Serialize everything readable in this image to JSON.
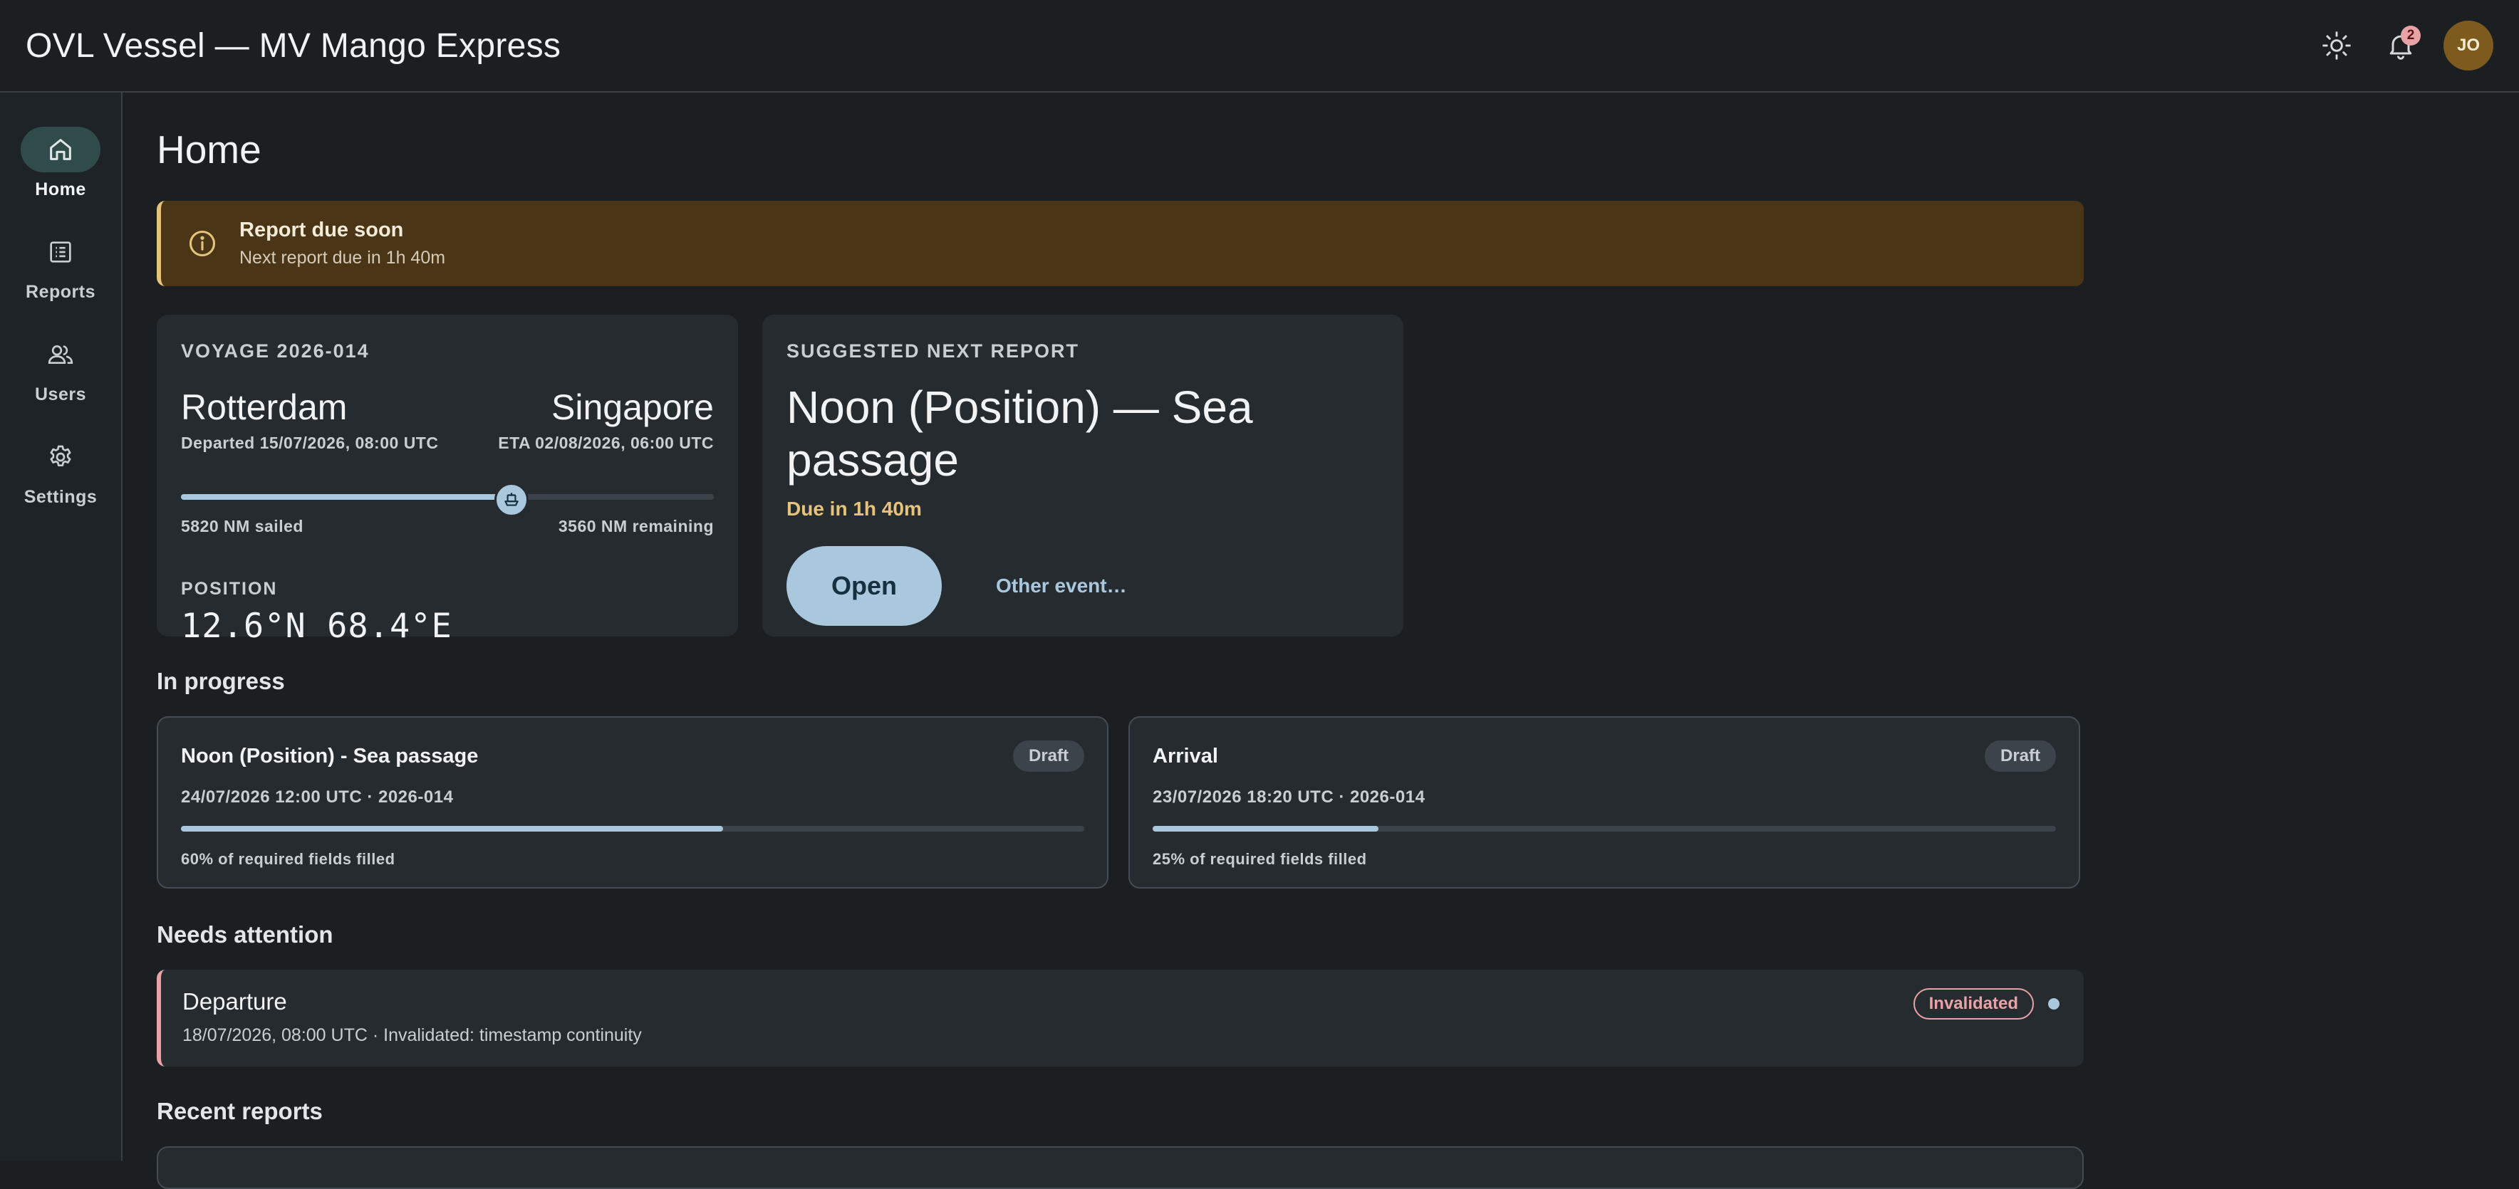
{
  "app": {
    "title": "OVL Vessel — MV Mango Express"
  },
  "header": {
    "notification_count": "2",
    "avatar_initials": "JO"
  },
  "sidebar": {
    "items": [
      {
        "label": "Home",
        "icon": "home-icon",
        "active": true
      },
      {
        "label": "Reports",
        "icon": "reports-icon",
        "active": false
      },
      {
        "label": "Users",
        "icon": "users-icon",
        "active": false
      },
      {
        "label": "Settings",
        "icon": "gear-icon",
        "active": false
      }
    ]
  },
  "page": {
    "title": "Home"
  },
  "banner": {
    "title": "Report due soon",
    "subtitle": "Next report due in 1h 40m"
  },
  "voyage": {
    "label": "VOYAGE 2026-014",
    "origin": "Rotterdam",
    "destination": "Singapore",
    "departed": "Departed 15/07/2026, 08:00 UTC",
    "eta": "ETA 02/08/2026, 06:00 UTC",
    "sailed": "5820 NM sailed",
    "remaining": "3560 NM remaining",
    "progress_fraction": 0.62,
    "position_label": "POSITION",
    "position_value": "12.6°N 68.4°E"
  },
  "next_report": {
    "label": "SUGGESTED NEXT REPORT",
    "title": "Noon (Position) — Sea passage",
    "due": "Due in 1h 40m",
    "open_label": "Open",
    "other_label": "Other event…"
  },
  "sections": {
    "in_progress": "In progress",
    "needs_attention": "Needs attention",
    "recent_reports": "Recent reports"
  },
  "in_progress": [
    {
      "title": "Noon (Position) - Sea passage",
      "status": "Draft",
      "meta": "24/07/2026 12:00 UTC · 2026-014",
      "progress": 0.6,
      "footer": "60% of required fields filled"
    },
    {
      "title": "Arrival",
      "status": "Draft",
      "meta": "23/07/2026 18:20 UTC · 2026-014",
      "progress": 0.25,
      "footer": "25% of required fields filled"
    }
  ],
  "attention": {
    "title": "Departure",
    "subtitle": "18/07/2026, 08:00 UTC · Invalidated: timestamp continuity",
    "status": "Invalidated"
  },
  "colors": {
    "accent": "#a9c8dd",
    "warning": "#e6c37a",
    "error": "#e8a3a6",
    "surface": "#262b30",
    "background": "#1b1f22"
  }
}
